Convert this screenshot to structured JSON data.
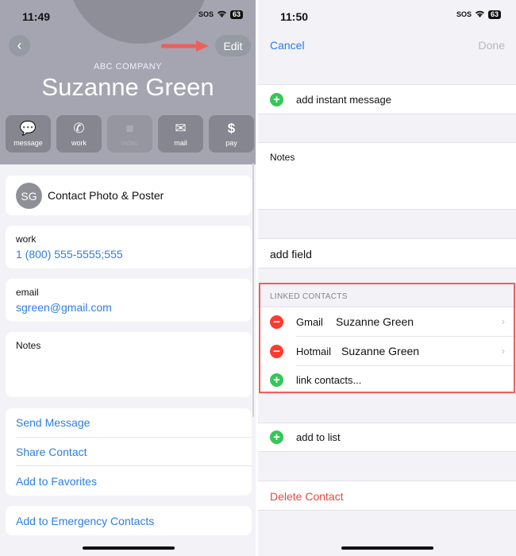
{
  "left": {
    "status_bar": {
      "time": "11:49",
      "sos": "SOS",
      "battery": "63"
    },
    "header": {
      "back_icon": "chevron-left",
      "edit_label": "Edit",
      "company": "ABC COMPANY",
      "name": "Suzanne Green",
      "annotation_arrow_color": "#ec605a"
    },
    "actions": [
      {
        "icon": "💬",
        "label": "message",
        "enabled": true
      },
      {
        "icon": "✆",
        "label": "work",
        "enabled": true
      },
      {
        "icon": "■",
        "label": "video",
        "enabled": false
      },
      {
        "icon": "✉",
        "label": "mail",
        "enabled": true
      },
      {
        "icon": "$",
        "label": "pay",
        "enabled": true
      }
    ],
    "photo_card": {
      "initials": "SG",
      "label": "Contact Photo & Poster"
    },
    "phone": {
      "label": "work",
      "value": "1 (800) 555-5555;555"
    },
    "email": {
      "label": "email",
      "value": "sgreen@gmail.com"
    },
    "notes": {
      "label": "Notes"
    },
    "links": [
      "Send Message",
      "Share Contact",
      "Add to Favorites"
    ],
    "emergency": "Add to Emergency Contacts"
  },
  "right": {
    "status_bar": {
      "time": "11:50",
      "sos": "SOS",
      "battery": "63"
    },
    "nav": {
      "cancel": "Cancel",
      "done": "Done"
    },
    "add_instant_message": "add instant message",
    "notes": {
      "label": "Notes"
    },
    "add_field": "add field",
    "linked_contacts": {
      "header": "LINKED CONTACTS",
      "items": [
        {
          "source": "Gmail",
          "name": "Suzanne Green"
        },
        {
          "source": "Hotmail",
          "name": "Suzanne Green"
        }
      ],
      "link_label": "link contacts..."
    },
    "add_to_list": "add to list",
    "delete_contact": "Delete Contact"
  },
  "colors": {
    "accent": "#2c7ee0",
    "destructive": "#e5483f",
    "add": "#34c759",
    "remove": "#ff3b30",
    "highlight_box": "#ec605a"
  }
}
